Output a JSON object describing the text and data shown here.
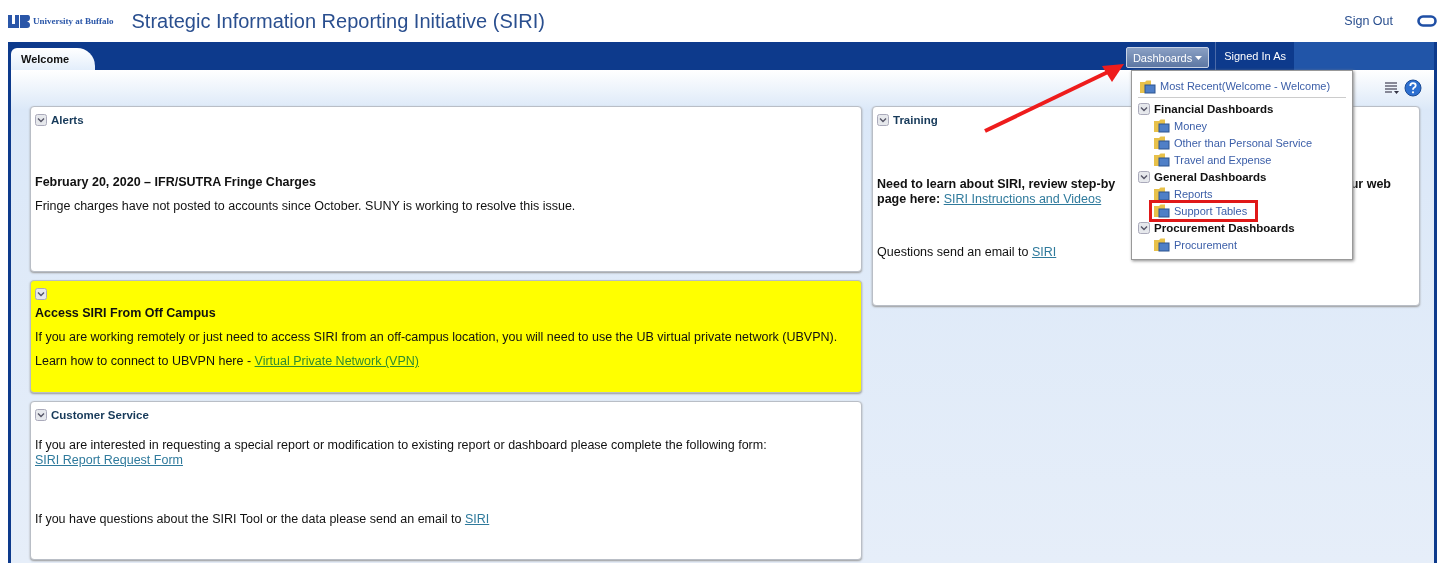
{
  "header": {
    "logo_text": "University at Buffalo",
    "title": "Strategic Information Reporting Initiative (SIRI)",
    "sign_out": "Sign Out"
  },
  "tabs": [
    {
      "label": "Welcome",
      "selected": true
    }
  ],
  "nav": {
    "dashboards": "Dashboards",
    "signed_in": "Signed In As"
  },
  "dashboards_menu": {
    "items": [
      {
        "kind": "recent",
        "label": "Most Recent(Welcome - Welcome)"
      },
      {
        "kind": "group",
        "label": "Financial Dashboards",
        "expanded": true,
        "children": [
          {
            "label": "Money",
            "highlighted": false
          },
          {
            "label": "Other than Personal Service",
            "highlighted": false
          },
          {
            "label": "Travel and Expense",
            "highlighted": false
          }
        ]
      },
      {
        "kind": "group",
        "label": "General Dashboards",
        "expanded": true,
        "children": [
          {
            "label": "Reports",
            "highlighted": false
          },
          {
            "label": "Support Tables",
            "highlighted": true
          }
        ]
      },
      {
        "kind": "group",
        "label": "Procurement Dashboards",
        "expanded": true,
        "children": [
          {
            "label": "Procurement",
            "highlighted": false
          }
        ]
      }
    ]
  },
  "alerts": {
    "title": "Alerts",
    "headline": "February 20, 2020 – IFR/SUTRA Fringe Charges",
    "text": "Fringe charges have not posted to accounts since October. SUNY is working to resolve this issue."
  },
  "off_campus": {
    "title": "Access SIRI From Off Campus",
    "text": "If you are working remotely or just need to access SIRI from an off-campus location, you will need to use the UB virtual private network (UBVPN).",
    "link_prefix": "Learn how to connect to UBVPN here - ",
    "link": "Virtual Private Network (VPN)"
  },
  "customer_service": {
    "title": "Customer Service",
    "request_text": "If you are interested in requesting a special report or modification to existing report or dashboard please complete the following form: ",
    "request_link": "SIRI Report Request Form",
    "email_text": "If you have questions about the SIRI Tool or the data please send an email to ",
    "email_link": "SIRI"
  },
  "training": {
    "title": "Training",
    "intro_visible": "Need to learn about SIRI, review step-by",
    "intro_tail": "ur web",
    "page_label": "page here:",
    "link": "SIRI Instructions and Videos",
    "email_text": "Questions send an email to ",
    "email_link": "SIRI"
  }
}
